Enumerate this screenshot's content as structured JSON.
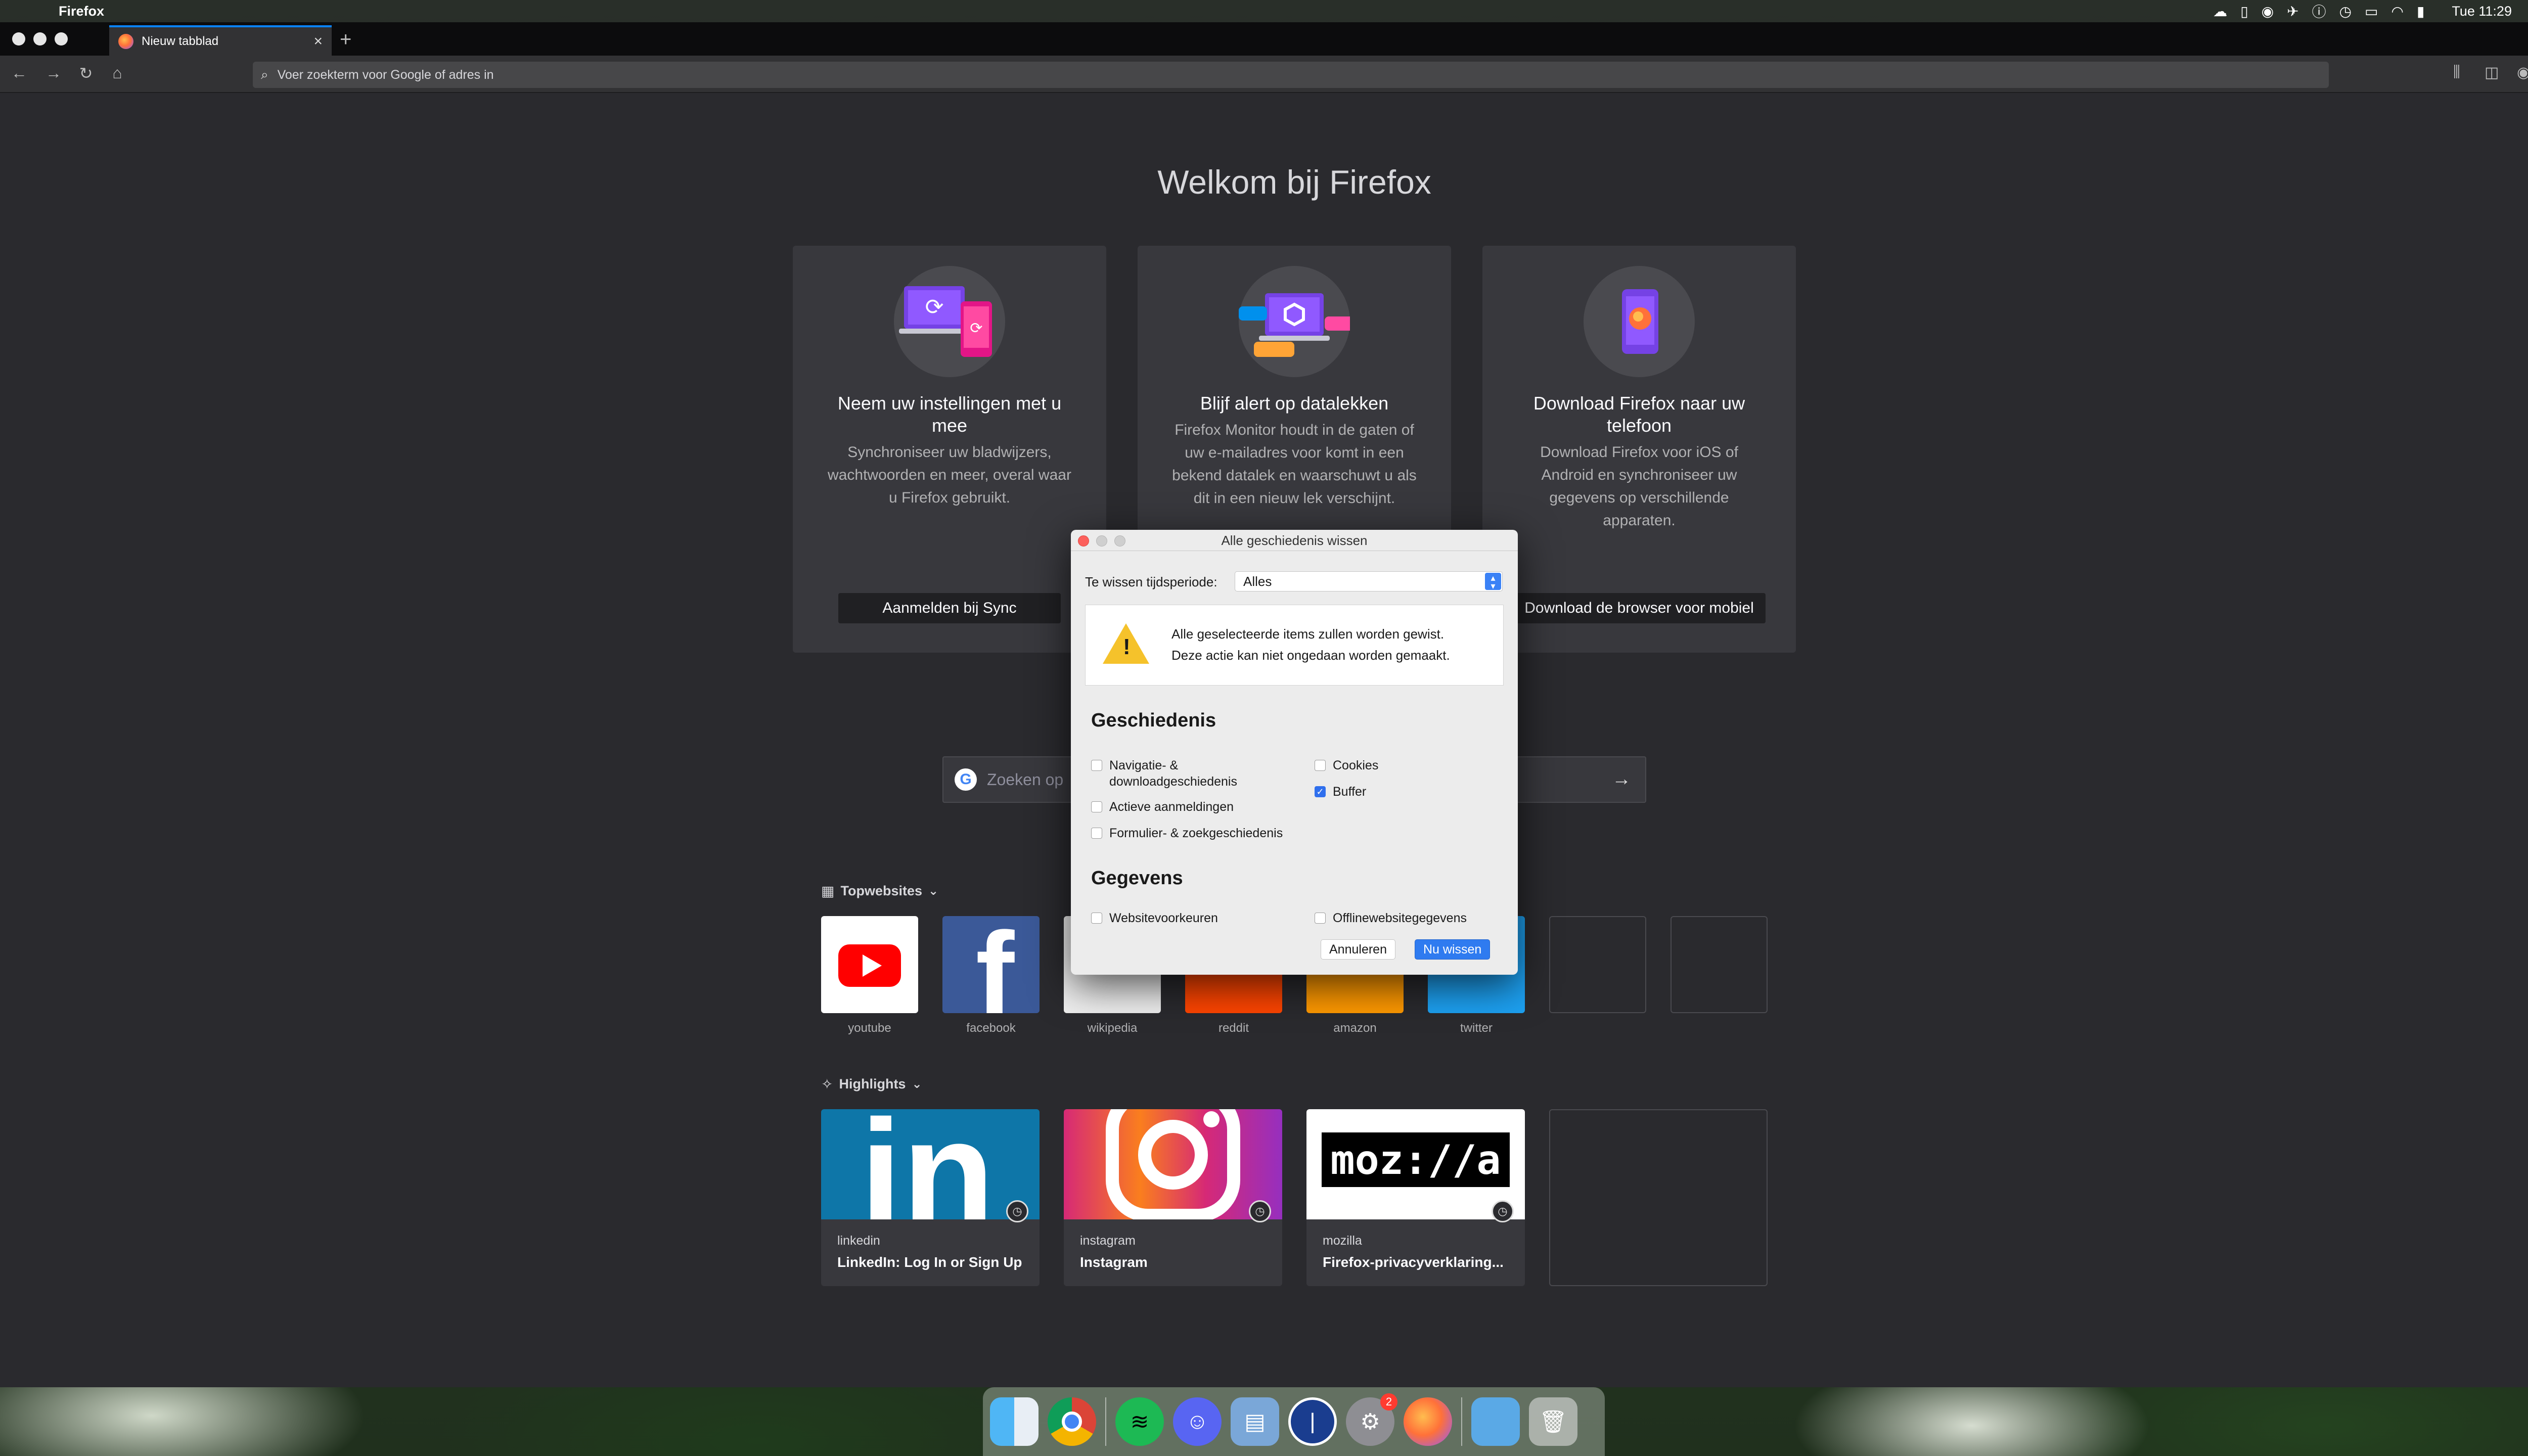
{
  "menubar": {
    "app_name": "Firefox",
    "clock": "Tue 11:29"
  },
  "browser": {
    "tab_title": "Nieuw tabblad",
    "url_placeholder": "Voer zoekterm voor Google of adres in"
  },
  "welcome": {
    "title": "Welkom bij Firefox",
    "cards": [
      {
        "title": "Neem uw instellingen met u mee",
        "body": "Synchroniseer uw bladwijzers, wachtwoorden en meer, overal waar u Firefox gebruikt.",
        "button": "Aanmelden bij Sync"
      },
      {
        "title": "Blijf alert op datalekken",
        "body": "Firefox Monitor houdt in de gaten of uw e-mailadres voor komt in een bekend datalek en waarschuwt u als dit in een nieuw lek verschijnt.",
        "button": ""
      },
      {
        "title": "Download Firefox naar uw telefoon",
        "body": "Download Firefox voor iOS of Android en synchroniseer uw gegevens op verschillende apparaten.",
        "button": "Download de browser voor mobiel"
      }
    ]
  },
  "search": {
    "placeholder": "Zoeken op"
  },
  "topsites": {
    "label": "Topwebsites",
    "items": [
      {
        "label": "youtube"
      },
      {
        "label": "facebook"
      },
      {
        "label": "wikipedia"
      },
      {
        "label": "reddit"
      },
      {
        "label": "amazon"
      },
      {
        "label": "twitter"
      }
    ]
  },
  "highlights": {
    "label": "Highlights",
    "items": [
      {
        "host": "linkedin",
        "title": "LinkedIn: Log In or Sign Up"
      },
      {
        "host": "instagram",
        "title": "Instagram"
      },
      {
        "host": "mozilla",
        "title": "Firefox-privacyverklaring..."
      }
    ]
  },
  "dialog": {
    "title": "Alle geschiedenis wissen",
    "period_label": "Te wissen tijdsperiode:",
    "period_value": "Alles",
    "warning_line1": "Alle geselecteerde items zullen worden gewist.",
    "warning_line2": "Deze actie kan niet ongedaan worden gemaakt.",
    "history_heading": "Geschiedenis",
    "history_items": [
      {
        "label": "Navigatie- & downloadgeschiedenis",
        "checked": false
      },
      {
        "label": "Actieve aanmeldingen",
        "checked": false
      },
      {
        "label": "Formulier- & zoekgeschiedenis",
        "checked": false
      },
      {
        "label": "Cookies",
        "checked": false
      },
      {
        "label": "Buffer",
        "checked": true
      }
    ],
    "data_heading": "Gegevens",
    "data_items": [
      {
        "label": "Websitevoorkeuren",
        "checked": false
      },
      {
        "label": "Offlinewebsitegegevens",
        "checked": false
      }
    ],
    "cancel_label": "Annuleren",
    "confirm_label": "Nu wissen"
  },
  "dock": {
    "items": [
      "finder-icon",
      "chrome-icon",
      "spotify-icon",
      "discord-icon",
      "preview-icon",
      "1password-icon",
      "system-preferences-icon",
      "firefox-icon",
      "folder-icon",
      "trash-icon"
    ],
    "system_preferences_badge": "2"
  }
}
